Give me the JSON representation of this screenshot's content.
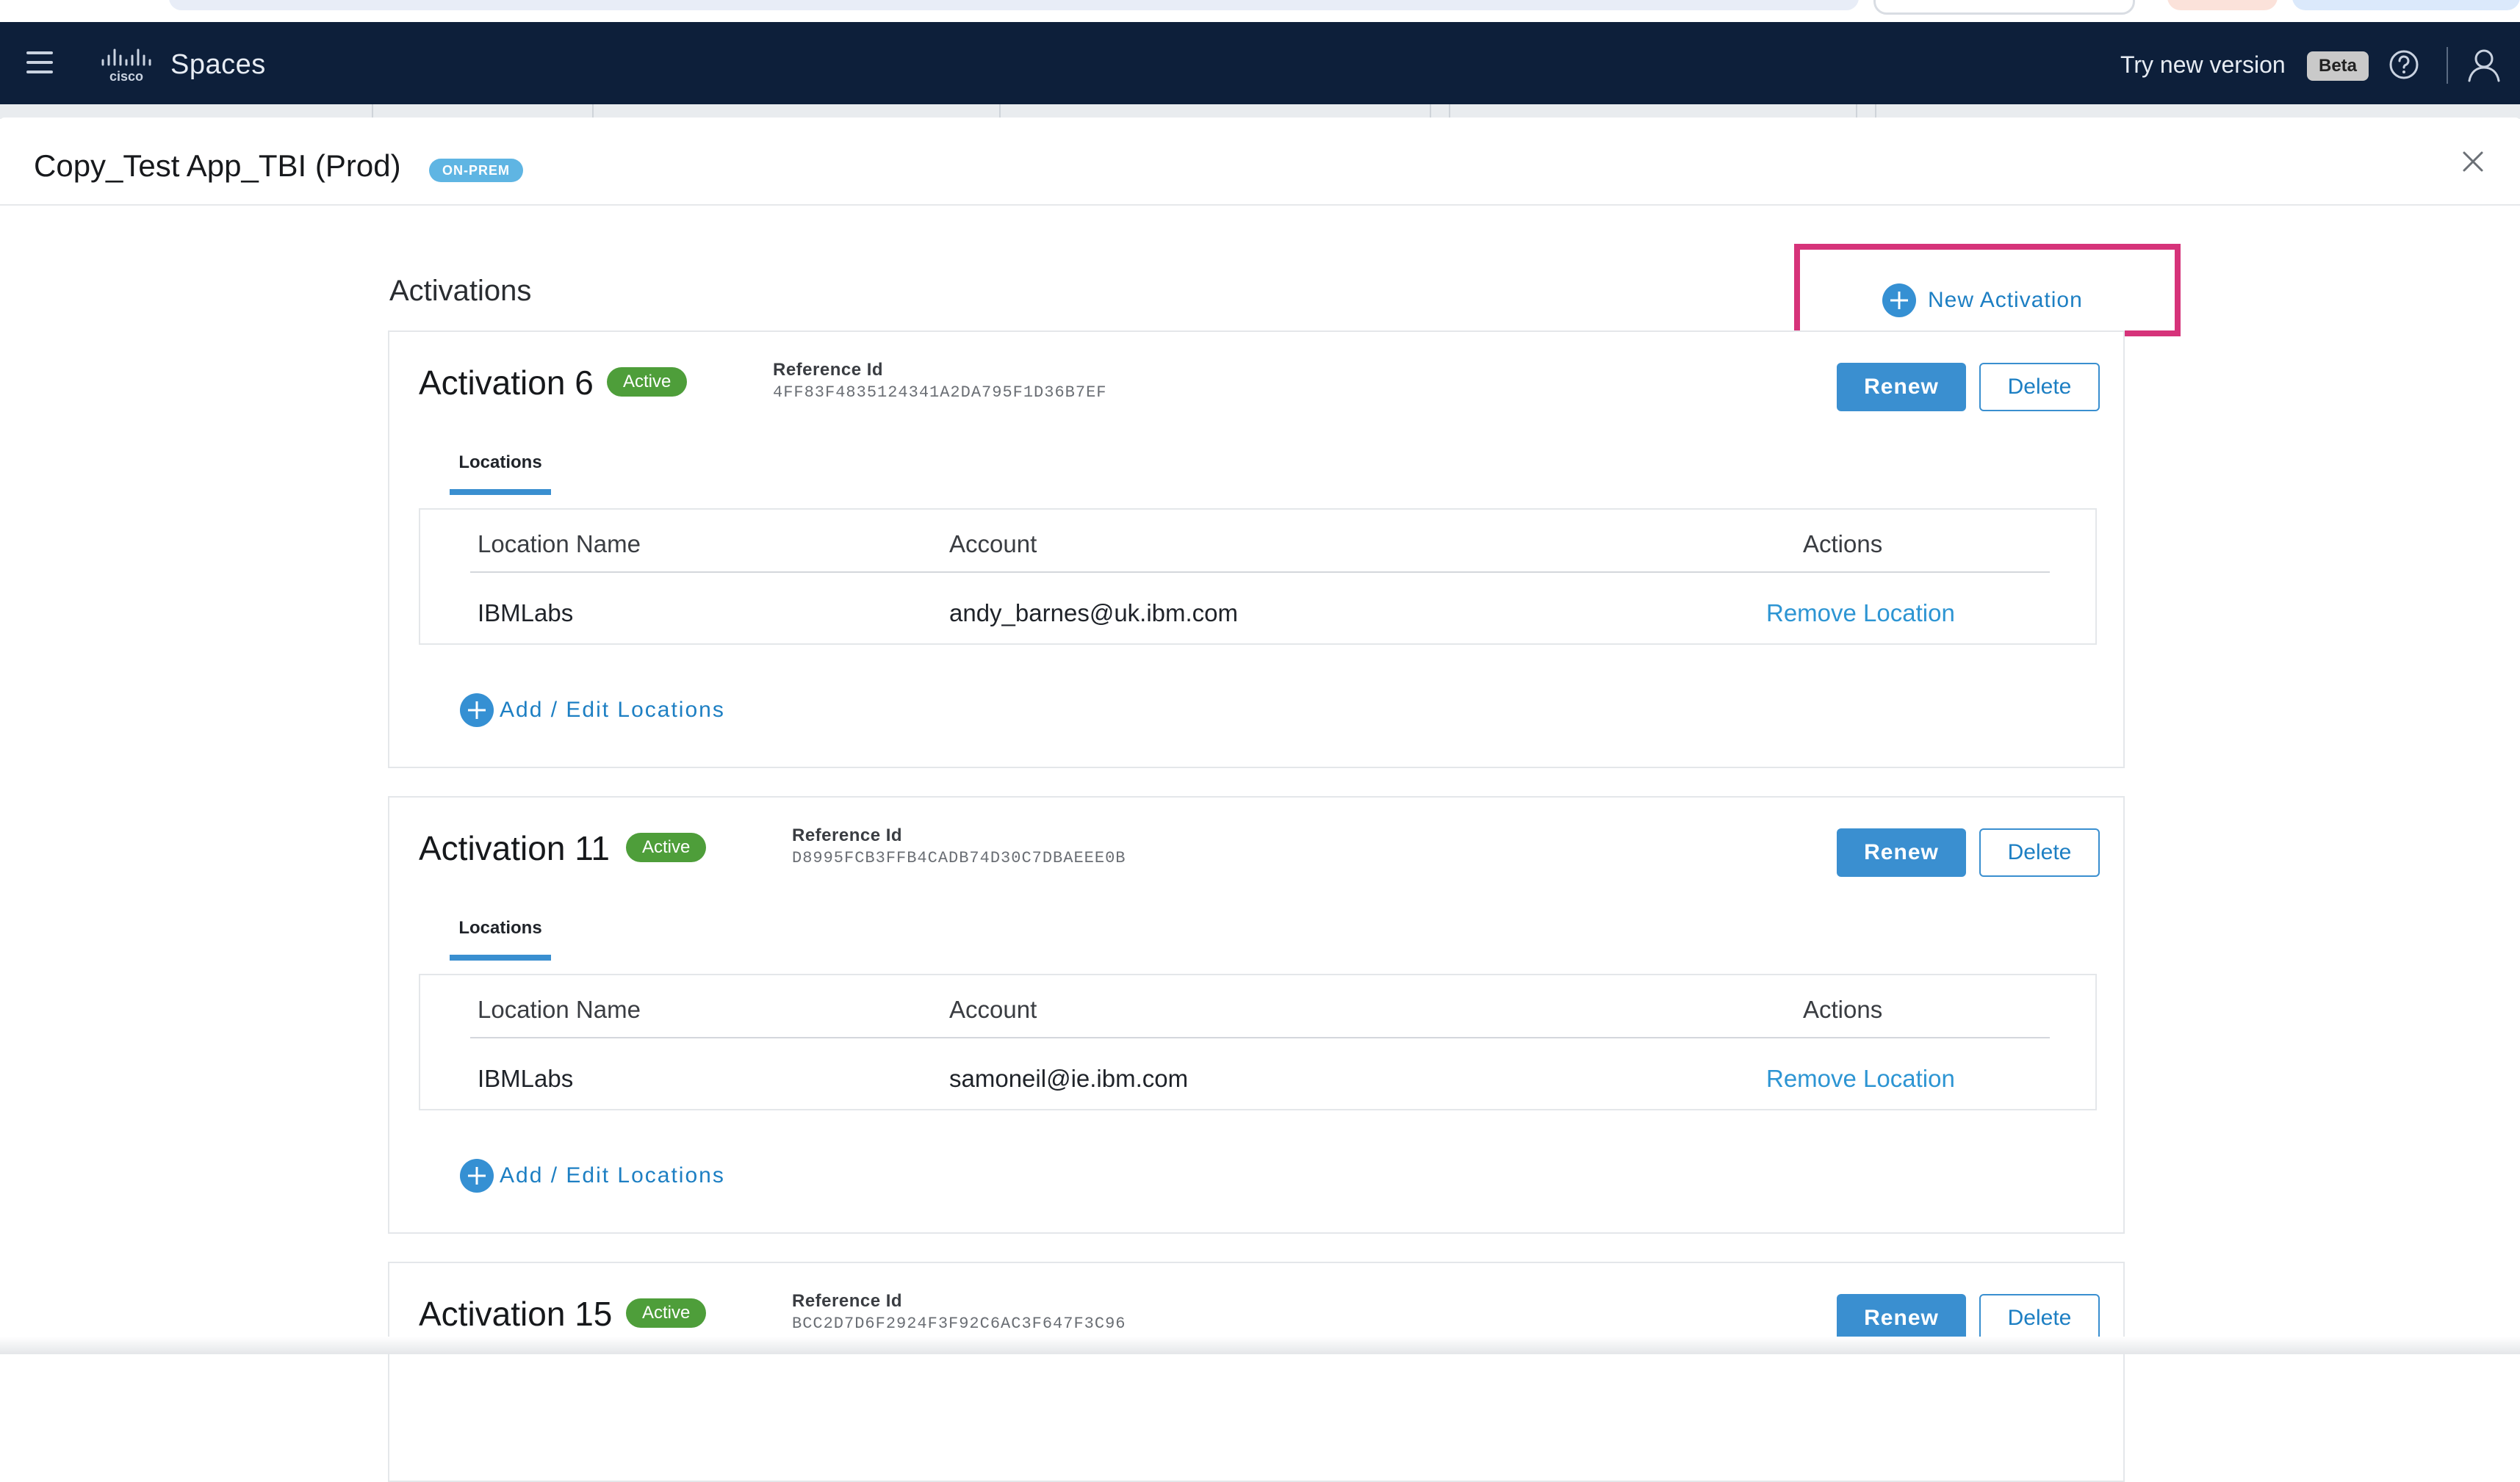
{
  "header": {
    "product_name": "Spaces",
    "try_new_label": "Try new version",
    "beta_label": "Beta"
  },
  "modal": {
    "title": "Copy_Test App_TBI (Prod)",
    "badge": "ON-PREM",
    "section_title": "Activations",
    "new_activation_label": "New Activation"
  },
  "colors": {
    "header_bg": "#0d1f3a",
    "accent_blue": "#3a8fd0",
    "active_green": "#4e9e3a",
    "highlight_pink": "#d6337a"
  },
  "activations": [
    {
      "name": "Activation 6",
      "status": "Active",
      "ref_label": "Reference Id",
      "ref_id": "4FF83F4835124341A2DA795F1D36B7EF",
      "renew_label": "Renew",
      "delete_label": "Delete",
      "tab_label": "Locations",
      "columns": [
        "Location Name",
        "Account",
        "Actions"
      ],
      "row": {
        "location": "IBMLabs",
        "account": "andy_barnes@uk.ibm.com",
        "action": "Remove Location"
      },
      "add_edit_label": "Add / Edit Locations"
    },
    {
      "name": "Activation 11",
      "status": "Active",
      "ref_label": "Reference Id",
      "ref_id": "D8995FCB3FFB4CADB74D30C7DBAEEE0B",
      "renew_label": "Renew",
      "delete_label": "Delete",
      "tab_label": "Locations",
      "columns": [
        "Location Name",
        "Account",
        "Actions"
      ],
      "row": {
        "location": "IBMLabs",
        "account": "samoneil@ie.ibm.com",
        "action": "Remove Location"
      },
      "add_edit_label": "Add / Edit Locations"
    },
    {
      "name": "Activation 15",
      "status": "Active",
      "ref_label": "Reference Id",
      "ref_id": "BCC2D7D6F2924F3F92C6AC3F647F3C96",
      "renew_label": "Renew",
      "delete_label": "Delete"
    }
  ]
}
